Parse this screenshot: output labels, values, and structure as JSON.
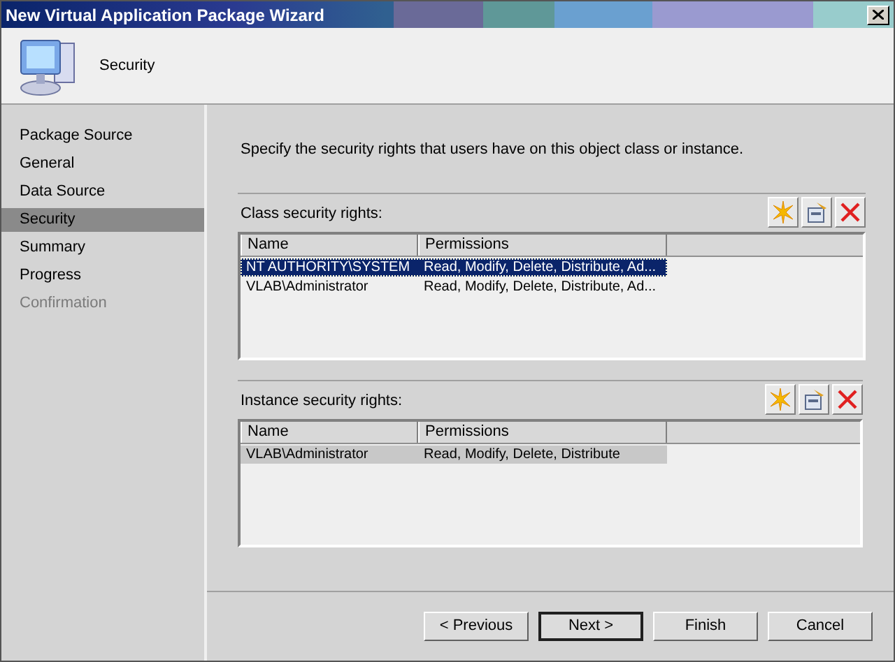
{
  "window": {
    "title": "New Virtual Application Package Wizard"
  },
  "header": {
    "title": "Security"
  },
  "steps": [
    {
      "label": "Package Source",
      "selected": false,
      "disabled": false
    },
    {
      "label": "General",
      "selected": false,
      "disabled": false
    },
    {
      "label": "Data Source",
      "selected": false,
      "disabled": false
    },
    {
      "label": "Security",
      "selected": true,
      "disabled": false
    },
    {
      "label": "Summary",
      "selected": false,
      "disabled": false
    },
    {
      "label": "Progress",
      "selected": false,
      "disabled": false
    },
    {
      "label": "Confirmation",
      "selected": false,
      "disabled": true
    }
  ],
  "instruction": "Specify the security rights that users have on this object class or instance.",
  "groups": [
    {
      "label": "Class security rights:",
      "columns": [
        "Name",
        "Permissions"
      ],
      "focused": true,
      "rows": [
        {
          "cells": [
            "NT AUTHORITY\\SYSTEM",
            "Read, Modify, Delete, Distribute, Ad..."
          ],
          "selected": true
        },
        {
          "cells": [
            "VLAB\\Administrator",
            "Read, Modify, Delete, Distribute, Ad..."
          ],
          "selected": false
        }
      ]
    },
    {
      "label": "Instance security rights:",
      "columns": [
        "Name",
        "Permissions"
      ],
      "focused": false,
      "rows": [
        {
          "cells": [
            "VLAB\\Administrator",
            "Read, Modify, Delete, Distribute"
          ],
          "selected": true
        }
      ]
    }
  ],
  "buttons": [
    {
      "label": "< Previous",
      "default": false
    },
    {
      "label": "Next >",
      "default": true
    },
    {
      "label": "Finish",
      "default": false
    },
    {
      "label": "Cancel",
      "default": false
    }
  ]
}
